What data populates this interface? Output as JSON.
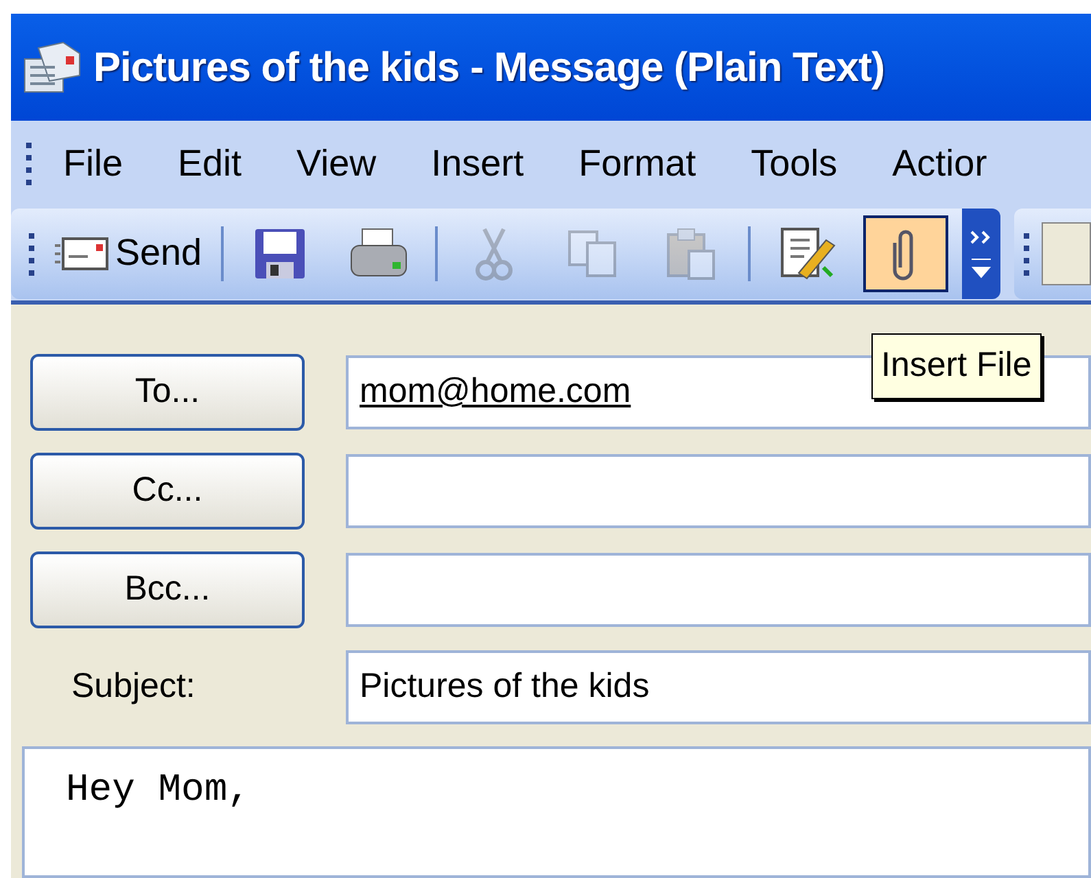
{
  "window": {
    "title": "Pictures of the kids - Message (Plain Text)"
  },
  "menu": [
    {
      "label": "File"
    },
    {
      "label": "Edit"
    },
    {
      "label": "View"
    },
    {
      "label": "Insert"
    },
    {
      "label": "Format"
    },
    {
      "label": "Tools"
    },
    {
      "label": "Actior"
    }
  ],
  "toolbar": {
    "send": {
      "label": "Send"
    },
    "buttons": [
      {
        "kind": "save",
        "disabled": false,
        "selected": false
      },
      {
        "kind": "print",
        "disabled": false,
        "selected": false
      },
      {
        "kind": "sep"
      },
      {
        "kind": "cut",
        "disabled": true,
        "selected": false
      },
      {
        "kind": "copy",
        "disabled": true,
        "selected": false
      },
      {
        "kind": "paste",
        "disabled": true,
        "selected": false
      },
      {
        "kind": "sep"
      },
      {
        "kind": "check",
        "disabled": false,
        "selected": false
      },
      {
        "kind": "attach",
        "disabled": false,
        "selected": true
      }
    ]
  },
  "tooltip": "Insert File",
  "fields": [
    {
      "kind": "button",
      "label": "To...",
      "value": "mom@home.com"
    },
    {
      "kind": "button",
      "label": "Cc..."
    },
    {
      "kind": "button",
      "label": "Bcc..."
    },
    {
      "kind": "label",
      "label": "Subject:",
      "value": "Pictures of the kids"
    }
  ],
  "body": "Hey Mom,"
}
